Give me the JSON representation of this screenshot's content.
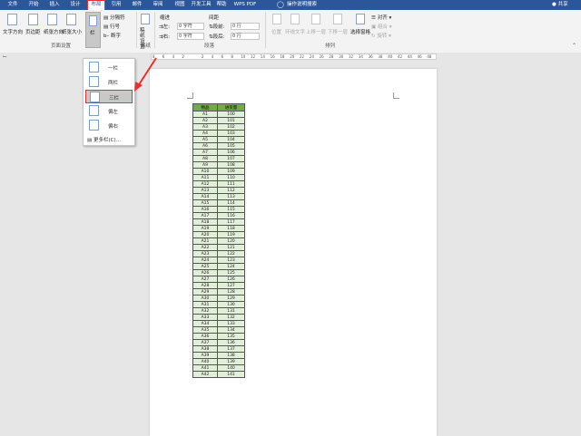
{
  "menu": {
    "tabs": [
      "文件",
      "开始",
      "插入",
      "设计",
      "布局",
      "引用",
      "邮件",
      "审阅",
      "视图",
      "开发工具",
      "帮助",
      "WPS PDF"
    ],
    "active_tab": "布局",
    "tell_me": "操作说明搜索",
    "share": "共享"
  },
  "ribbon": {
    "page_setup": {
      "text_direction": "文字方向",
      "margins": "页边距",
      "orientation": "纸张方向",
      "size": "纸张大小",
      "columns": "栏",
      "breaks": "分隔符",
      "line_numbers": "行号",
      "hyphenation": "断字",
      "group_label": "页面设置"
    },
    "draft": {
      "label": "稿纸设置",
      "group_label": "稿纸"
    },
    "paragraph": {
      "indent_label": "缩进",
      "spacing_label": "间距",
      "left_label": "左:",
      "right_label": "右:",
      "before_label": "段前:",
      "after_label": "段后:",
      "left_value": "0 字符",
      "right_value": "0 字符",
      "before_value": "0 行",
      "after_value": "0 行",
      "group_label": "段落"
    },
    "arrange": {
      "position": "位置",
      "wrap_text": "环绕文字",
      "bring_forward": "上移一层",
      "send_backward": "下移一层",
      "selection_pane": "选择窗格",
      "align": "对齐",
      "group": "组合",
      "rotate": "旋转",
      "group_label": "排列"
    }
  },
  "ruler_numbers": [
    "8",
    "6",
    "4",
    "2",
    "",
    "2",
    "4",
    "6",
    "8",
    "10",
    "12",
    "14",
    "16",
    "18",
    "20",
    "22",
    "24",
    "26",
    "28",
    "30",
    "32",
    "34",
    "36",
    "38",
    "40",
    "42",
    "44",
    "46",
    "48"
  ],
  "columns_menu": {
    "items": [
      "一栏",
      "两栏",
      "三栏",
      "偏左",
      "偏右"
    ],
    "selected": "三栏",
    "more": "更多栏(C)..."
  },
  "table": {
    "headers": [
      "物品",
      "进货量"
    ],
    "rows": [
      [
        "A1",
        "100"
      ],
      [
        "A2",
        "101"
      ],
      [
        "A3",
        "102"
      ],
      [
        "A4",
        "103"
      ],
      [
        "A5",
        "104"
      ],
      [
        "A6",
        "105"
      ],
      [
        "A7",
        "106"
      ],
      [
        "A8",
        "107"
      ],
      [
        "A9",
        "108"
      ],
      [
        "A10",
        "109"
      ],
      [
        "A11",
        "110"
      ],
      [
        "A12",
        "111"
      ],
      [
        "A13",
        "112"
      ],
      [
        "A14",
        "113"
      ],
      [
        "A15",
        "114"
      ],
      [
        "A16",
        "115"
      ],
      [
        "A17",
        "116"
      ],
      [
        "A18",
        "117"
      ],
      [
        "A19",
        "118"
      ],
      [
        "A20",
        "119"
      ],
      [
        "A21",
        "120"
      ],
      [
        "A22",
        "121"
      ],
      [
        "A23",
        "122"
      ],
      [
        "A24",
        "123"
      ],
      [
        "A25",
        "124"
      ],
      [
        "A26",
        "125"
      ],
      [
        "A27",
        "126"
      ],
      [
        "A28",
        "127"
      ],
      [
        "A29",
        "128"
      ],
      [
        "A30",
        "129"
      ],
      [
        "A31",
        "130"
      ],
      [
        "A32",
        "131"
      ],
      [
        "A33",
        "132"
      ],
      [
        "A34",
        "133"
      ],
      [
        "A35",
        "134"
      ],
      [
        "A36",
        "135"
      ],
      [
        "A37",
        "136"
      ],
      [
        "A38",
        "137"
      ],
      [
        "A39",
        "138"
      ],
      [
        "A40",
        "139"
      ],
      [
        "A41",
        "140"
      ],
      [
        "A42",
        "141"
      ]
    ]
  },
  "colors": {
    "title_bar": "#2b579a",
    "highlight": "#e8322f",
    "table_header": "#70ad47",
    "table_cell": "#e2efd9"
  }
}
